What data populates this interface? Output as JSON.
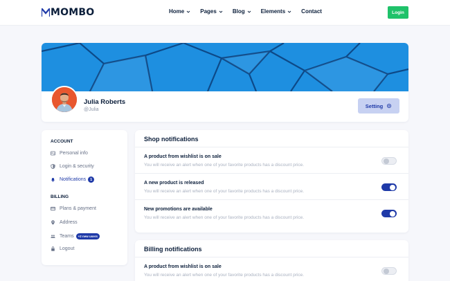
{
  "header": {
    "logo": "MOMBO",
    "nav": [
      {
        "label": "Home",
        "dropdown": true
      },
      {
        "label": "Pages",
        "dropdown": true
      },
      {
        "label": "Blog",
        "dropdown": true
      },
      {
        "label": "Elements",
        "dropdown": true
      },
      {
        "label": "Contact",
        "dropdown": false
      }
    ],
    "login_label": "Login"
  },
  "profile": {
    "name": "Julia Roberts",
    "handle": "@Julia",
    "setting_label": "Setting"
  },
  "sidebar": {
    "account_heading": "ACCOUNT",
    "account_items": [
      {
        "label": "Personal info",
        "icon": "id-card-icon"
      },
      {
        "label": "Login & security",
        "icon": "shield-icon"
      },
      {
        "label": "Notifications",
        "icon": "bell-icon",
        "badge": "1",
        "active": true
      }
    ],
    "billing_heading": "BILLING",
    "billing_items": [
      {
        "label": "Plans & payment",
        "icon": "credit-card-icon"
      },
      {
        "label": "Address",
        "icon": "map-pin-icon"
      },
      {
        "label": "Teams",
        "icon": "users-icon",
        "badge": "+2 new users"
      },
      {
        "label": "Logout",
        "icon": "lock-icon"
      }
    ]
  },
  "shop_notifications": {
    "title": "Shop notifications",
    "items": [
      {
        "title": "A product from wishlist is on sale",
        "desc": "You will receive an alert when one of your favorite products has a discount price.",
        "enabled": false
      },
      {
        "title": "A new product is released",
        "desc": "You will receive an alert when one of your favorite products has a discount price.",
        "enabled": true
      },
      {
        "title": "New promotions are available",
        "desc": "You will receive an alert when one of your favorite products has a discount price.",
        "enabled": true
      }
    ]
  },
  "billing_notifications": {
    "title": "Billing notifications",
    "items": [
      {
        "title": "A product from wishlist is on sale",
        "desc": "You will receive an alert when one of your favorite products has a discount price.",
        "enabled": false
      }
    ]
  },
  "colors": {
    "primary": "#1f3aa8",
    "login": "#1fc26a",
    "banner": "#1e8fe0"
  }
}
